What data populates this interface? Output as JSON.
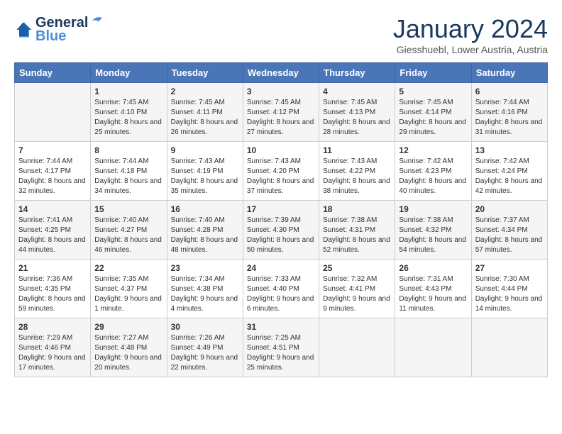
{
  "header": {
    "logo_line1": "General",
    "logo_line2": "Blue",
    "month_title": "January 2024",
    "subtitle": "Giesshuebl, Lower Austria, Austria"
  },
  "weekdays": [
    "Sunday",
    "Monday",
    "Tuesday",
    "Wednesday",
    "Thursday",
    "Friday",
    "Saturday"
  ],
  "weeks": [
    [
      {
        "day": "",
        "sunrise": "",
        "sunset": "",
        "daylight": ""
      },
      {
        "day": "1",
        "sunrise": "Sunrise: 7:45 AM",
        "sunset": "Sunset: 4:10 PM",
        "daylight": "Daylight: 8 hours and 25 minutes."
      },
      {
        "day": "2",
        "sunrise": "Sunrise: 7:45 AM",
        "sunset": "Sunset: 4:11 PM",
        "daylight": "Daylight: 8 hours and 26 minutes."
      },
      {
        "day": "3",
        "sunrise": "Sunrise: 7:45 AM",
        "sunset": "Sunset: 4:12 PM",
        "daylight": "Daylight: 8 hours and 27 minutes."
      },
      {
        "day": "4",
        "sunrise": "Sunrise: 7:45 AM",
        "sunset": "Sunset: 4:13 PM",
        "daylight": "Daylight: 8 hours and 28 minutes."
      },
      {
        "day": "5",
        "sunrise": "Sunrise: 7:45 AM",
        "sunset": "Sunset: 4:14 PM",
        "daylight": "Daylight: 8 hours and 29 minutes."
      },
      {
        "day": "6",
        "sunrise": "Sunrise: 7:44 AM",
        "sunset": "Sunset: 4:16 PM",
        "daylight": "Daylight: 8 hours and 31 minutes."
      }
    ],
    [
      {
        "day": "7",
        "sunrise": "Sunrise: 7:44 AM",
        "sunset": "Sunset: 4:17 PM",
        "daylight": "Daylight: 8 hours and 32 minutes."
      },
      {
        "day": "8",
        "sunrise": "Sunrise: 7:44 AM",
        "sunset": "Sunset: 4:18 PM",
        "daylight": "Daylight: 8 hours and 34 minutes."
      },
      {
        "day": "9",
        "sunrise": "Sunrise: 7:43 AM",
        "sunset": "Sunset: 4:19 PM",
        "daylight": "Daylight: 8 hours and 35 minutes."
      },
      {
        "day": "10",
        "sunrise": "Sunrise: 7:43 AM",
        "sunset": "Sunset: 4:20 PM",
        "daylight": "Daylight: 8 hours and 37 minutes."
      },
      {
        "day": "11",
        "sunrise": "Sunrise: 7:43 AM",
        "sunset": "Sunset: 4:22 PM",
        "daylight": "Daylight: 8 hours and 38 minutes."
      },
      {
        "day": "12",
        "sunrise": "Sunrise: 7:42 AM",
        "sunset": "Sunset: 4:23 PM",
        "daylight": "Daylight: 8 hours and 40 minutes."
      },
      {
        "day": "13",
        "sunrise": "Sunrise: 7:42 AM",
        "sunset": "Sunset: 4:24 PM",
        "daylight": "Daylight: 8 hours and 42 minutes."
      }
    ],
    [
      {
        "day": "14",
        "sunrise": "Sunrise: 7:41 AM",
        "sunset": "Sunset: 4:25 PM",
        "daylight": "Daylight: 8 hours and 44 minutes."
      },
      {
        "day": "15",
        "sunrise": "Sunrise: 7:40 AM",
        "sunset": "Sunset: 4:27 PM",
        "daylight": "Daylight: 8 hours and 46 minutes."
      },
      {
        "day": "16",
        "sunrise": "Sunrise: 7:40 AM",
        "sunset": "Sunset: 4:28 PM",
        "daylight": "Daylight: 8 hours and 48 minutes."
      },
      {
        "day": "17",
        "sunrise": "Sunrise: 7:39 AM",
        "sunset": "Sunset: 4:30 PM",
        "daylight": "Daylight: 8 hours and 50 minutes."
      },
      {
        "day": "18",
        "sunrise": "Sunrise: 7:38 AM",
        "sunset": "Sunset: 4:31 PM",
        "daylight": "Daylight: 8 hours and 52 minutes."
      },
      {
        "day": "19",
        "sunrise": "Sunrise: 7:38 AM",
        "sunset": "Sunset: 4:32 PM",
        "daylight": "Daylight: 8 hours and 54 minutes."
      },
      {
        "day": "20",
        "sunrise": "Sunrise: 7:37 AM",
        "sunset": "Sunset: 4:34 PM",
        "daylight": "Daylight: 8 hours and 57 minutes."
      }
    ],
    [
      {
        "day": "21",
        "sunrise": "Sunrise: 7:36 AM",
        "sunset": "Sunset: 4:35 PM",
        "daylight": "Daylight: 8 hours and 59 minutes."
      },
      {
        "day": "22",
        "sunrise": "Sunrise: 7:35 AM",
        "sunset": "Sunset: 4:37 PM",
        "daylight": "Daylight: 9 hours and 1 minute."
      },
      {
        "day": "23",
        "sunrise": "Sunrise: 7:34 AM",
        "sunset": "Sunset: 4:38 PM",
        "daylight": "Daylight: 9 hours and 4 minutes."
      },
      {
        "day": "24",
        "sunrise": "Sunrise: 7:33 AM",
        "sunset": "Sunset: 4:40 PM",
        "daylight": "Daylight: 9 hours and 6 minutes."
      },
      {
        "day": "25",
        "sunrise": "Sunrise: 7:32 AM",
        "sunset": "Sunset: 4:41 PM",
        "daylight": "Daylight: 9 hours and 9 minutes."
      },
      {
        "day": "26",
        "sunrise": "Sunrise: 7:31 AM",
        "sunset": "Sunset: 4:43 PM",
        "daylight": "Daylight: 9 hours and 11 minutes."
      },
      {
        "day": "27",
        "sunrise": "Sunrise: 7:30 AM",
        "sunset": "Sunset: 4:44 PM",
        "daylight": "Daylight: 9 hours and 14 minutes."
      }
    ],
    [
      {
        "day": "28",
        "sunrise": "Sunrise: 7:29 AM",
        "sunset": "Sunset: 4:46 PM",
        "daylight": "Daylight: 9 hours and 17 minutes."
      },
      {
        "day": "29",
        "sunrise": "Sunrise: 7:27 AM",
        "sunset": "Sunset: 4:48 PM",
        "daylight": "Daylight: 9 hours and 20 minutes."
      },
      {
        "day": "30",
        "sunrise": "Sunrise: 7:26 AM",
        "sunset": "Sunset: 4:49 PM",
        "daylight": "Daylight: 9 hours and 22 minutes."
      },
      {
        "day": "31",
        "sunrise": "Sunrise: 7:25 AM",
        "sunset": "Sunset: 4:51 PM",
        "daylight": "Daylight: 9 hours and 25 minutes."
      },
      {
        "day": "",
        "sunrise": "",
        "sunset": "",
        "daylight": ""
      },
      {
        "day": "",
        "sunrise": "",
        "sunset": "",
        "daylight": ""
      },
      {
        "day": "",
        "sunrise": "",
        "sunset": "",
        "daylight": ""
      }
    ]
  ]
}
